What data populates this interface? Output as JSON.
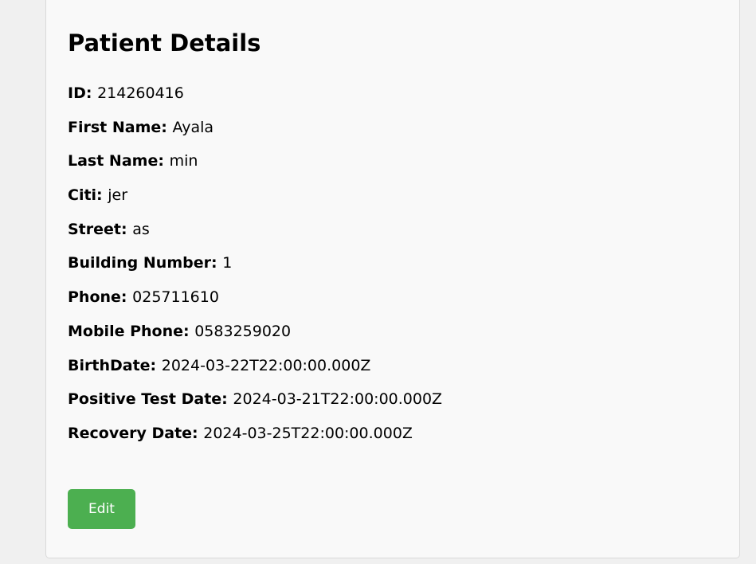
{
  "patient": {
    "title": "Patient Details",
    "fields": [
      {
        "label": "ID:",
        "value": "214260416"
      },
      {
        "label": "First Name:",
        "value": "Ayala"
      },
      {
        "label": "Last Name:",
        "value": "min"
      },
      {
        "label": "Citi:",
        "value": "jer"
      },
      {
        "label": "Street:",
        "value": "as"
      },
      {
        "label": "Building Number:",
        "value": "1"
      },
      {
        "label": "Phone:",
        "value": "025711610"
      },
      {
        "label": "Mobile Phone:",
        "value": "0583259020"
      },
      {
        "label": "BirthDate:",
        "value": "2024-03-22T22:00:00.000Z"
      },
      {
        "label": "Positive Test Date:",
        "value": "2024-03-21T22:00:00.000Z"
      },
      {
        "label": "Recovery Date:",
        "value": "2024-03-25T22:00:00.000Z"
      }
    ],
    "edit_label": "Edit"
  },
  "colors": {
    "button": "#4caf50",
    "card": "#f9f9f9",
    "background": "#f0f0f0"
  }
}
